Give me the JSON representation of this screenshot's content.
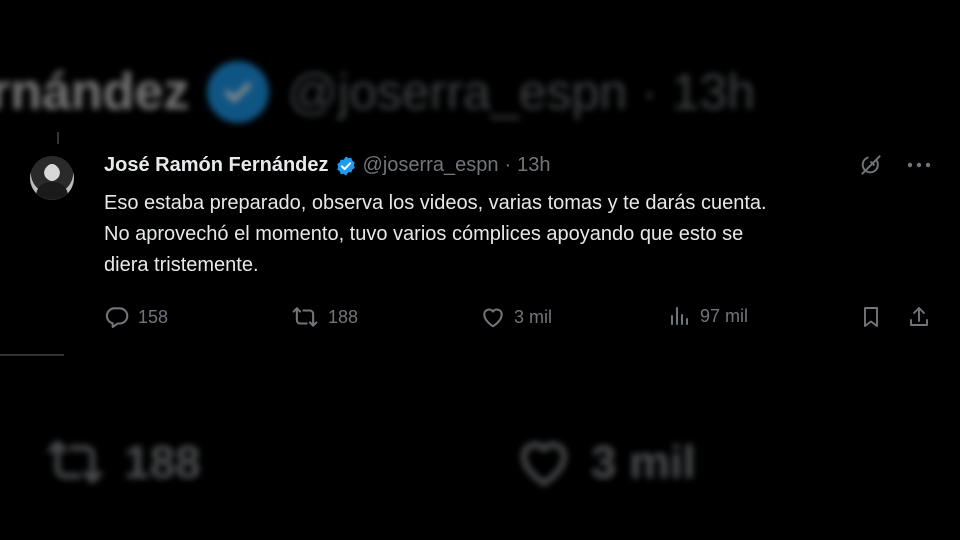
{
  "background": {
    "name_fragment": "rnández",
    "handle_time": "@joserra_espn · 13h",
    "retweets": "188",
    "likes": "3 mil"
  },
  "tweet": {
    "author_name": "José Ramón Fernández",
    "handle": "@joserra_espn",
    "separator": "·",
    "time": "13h",
    "lines": [
      "Eso estaba preparado, observa los videos, varias tomas y te darás cuenta.",
      "No aprovechó el momento, tuvo varios cómplices apoyando que esto se",
      "diera tristemente."
    ],
    "replies": "158",
    "retweets": "188",
    "likes": "3 mil",
    "views": "97 mil"
  },
  "colors": {
    "background": "#000000",
    "text": "#e7e9ea",
    "secondary": "#71767b",
    "verified": "#1d9bf0"
  },
  "icons": [
    "verified-badge-icon",
    "grok-icon",
    "more-icon",
    "reply-icon",
    "retweet-icon",
    "like-icon",
    "views-icon",
    "bookmark-icon",
    "share-icon"
  ]
}
